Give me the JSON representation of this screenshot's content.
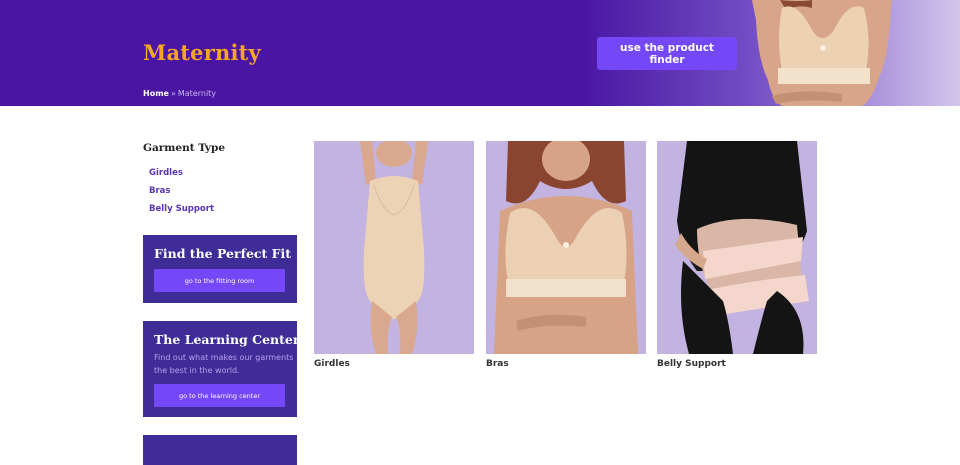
{
  "header": {
    "title": "Maternity",
    "breadcrumb": {
      "home": "Home",
      "separator": "»",
      "current": "Maternity"
    },
    "finder_button": "use the product finder",
    "colors": {
      "banner": "#4a15a2",
      "title": "#f5a623",
      "button": "#7447f7"
    }
  },
  "sidebar": {
    "filter_title": "Garment Type",
    "filters": [
      "Girdles",
      "Bras",
      "Belly Support"
    ],
    "promos": [
      {
        "title": "Find the Perfect Fit",
        "text": "",
        "button": "go to the fitting room"
      },
      {
        "title": "The Learning Center",
        "text": "Find out what makes our garments the best in the world.",
        "button": "go to the learning center"
      }
    ],
    "colors": {
      "promo_bg": "#3f2c96",
      "link": "#5a35b8"
    }
  },
  "products": [
    {
      "name": "Girdles"
    },
    {
      "name": "Bras"
    },
    {
      "name": "Belly Support"
    }
  ]
}
